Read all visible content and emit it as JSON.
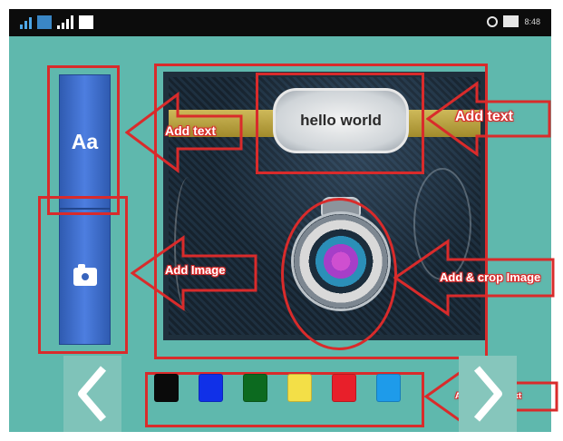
{
  "status_bar": {
    "left_badges": [
      "",
      ""
    ],
    "battery_label": "",
    "time": "8:48"
  },
  "editor": {
    "text_button_label": "Aa",
    "canvas_text": "hello world"
  },
  "annotations": {
    "add_text_left": "Add text",
    "add_text_right": "Add text",
    "add_image": "Add Image",
    "add_crop_image": "Add & crop Image",
    "add_color": "Add Color to text"
  },
  "icons": {
    "image_button": "camera-icon",
    "back": "chevron-left-icon",
    "next": "chevron-right-icon"
  },
  "color_swatches": [
    "#0a0a0a",
    "#1030e8",
    "#0c6a1f",
    "#f3df47",
    "#e81f2a",
    "#1e9bea"
  ],
  "theme": {
    "app_background": "#5fb8ad",
    "button_blue": "#3b6bc9",
    "annotation_red": "#d92b2b"
  }
}
